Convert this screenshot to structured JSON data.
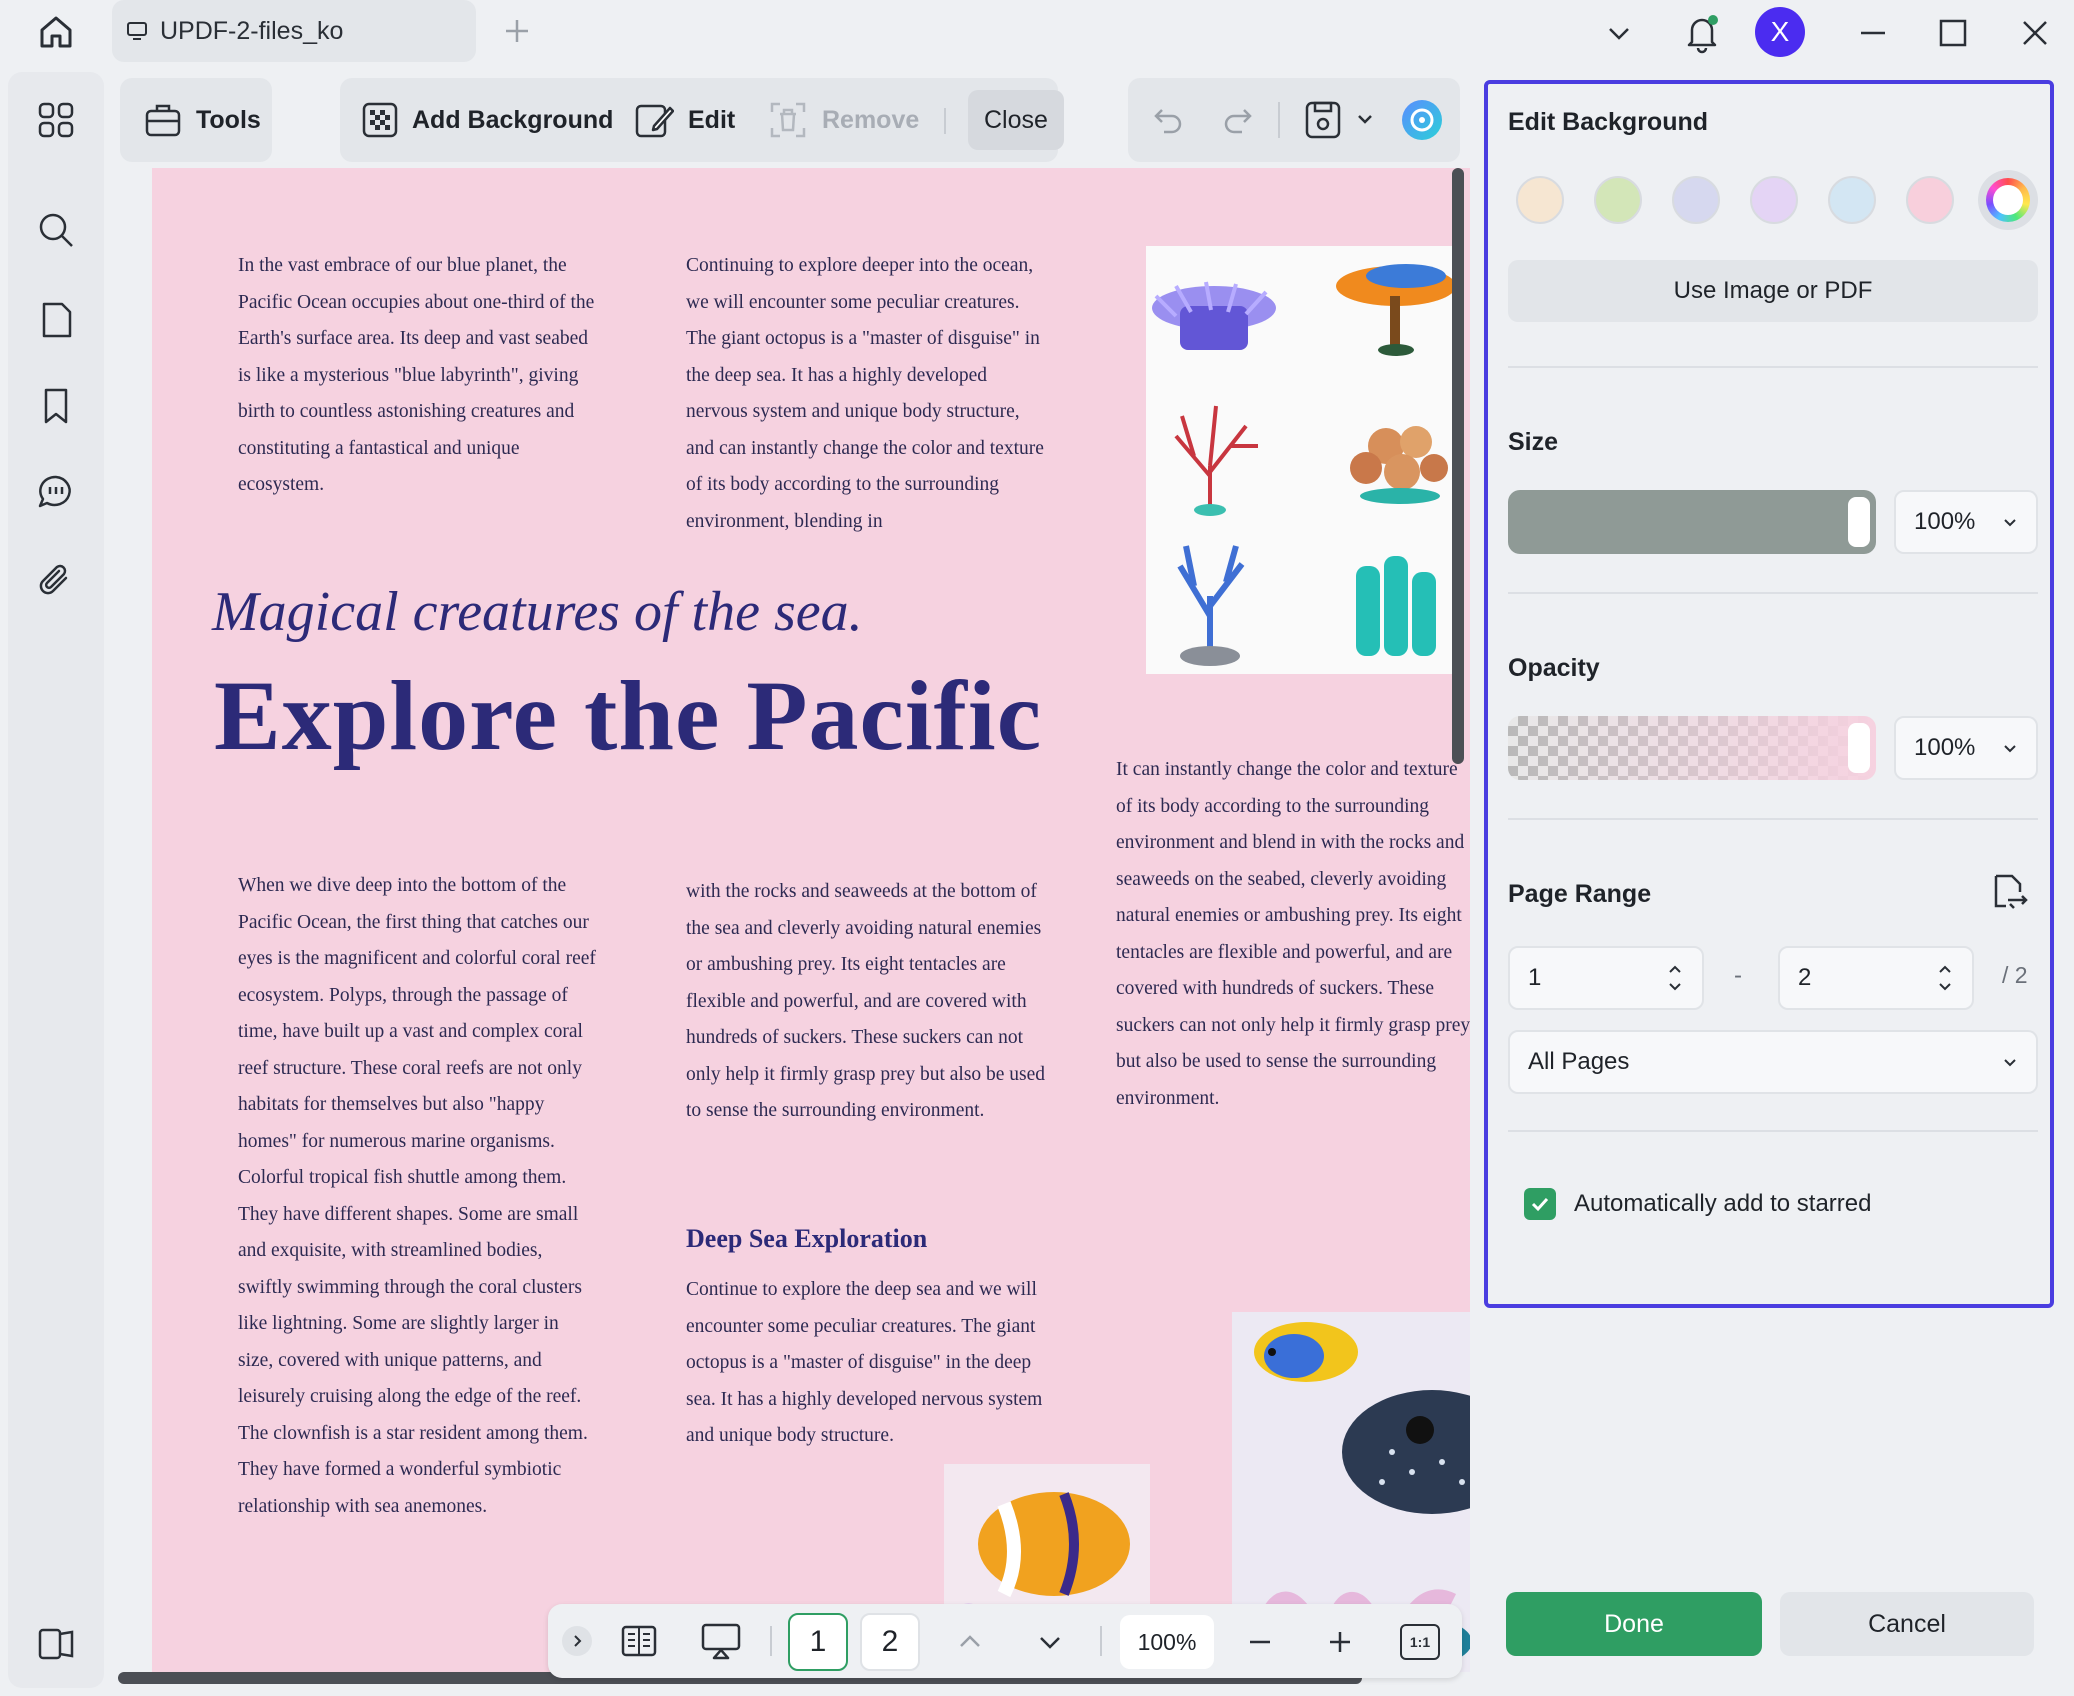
{
  "window": {
    "tab_title": "UPDF-2-files_ko",
    "avatar_letter": "X"
  },
  "toolbar": {
    "tools_label": "Tools",
    "add_background_label": "Add Background",
    "edit_label": "Edit",
    "remove_label": "Remove",
    "close_label": "Close"
  },
  "document": {
    "para1": "In the vast embrace of our blue planet, the Pacific Ocean occupies about one-third of the Earth's surface area. Its deep and vast seabed is like a mysterious \"blue labyrinth\", giving birth to countless astonishing creatures and constituting a fantastical and unique ecosystem.",
    "para2": "Continuing to explore deeper into the ocean, we will encounter some peculiar creatures. The giant octopus is a \"master of disguise\" in the deep sea. It has a highly developed nervous system and unique body structure, and can instantly change the color and texture of its body according to the surrounding environment, blending in",
    "subtitle": "Magical creatures of the sea.",
    "title": "Explore the Pacific",
    "para3": "It can instantly change the color and texture of its body according to the surrounding environment and blend in with the rocks and seaweeds on the seabed, cleverly avoiding natural enemies or ambushing prey. Its eight tentacles are flexible and powerful, and are covered with hundreds of suckers. These suckers can not only help it firmly grasp prey but also be used to sense the surrounding environment.",
    "para4": "When we dive deep into the bottom of the Pacific Ocean, the first thing that catches our eyes is the magnificent and colorful coral reef ecosystem. Polyps, through the passage of time, have built up a vast and complex coral reef structure. These coral reefs are not only habitats for themselves but also \"happy homes\" for numerous marine organisms. Colorful tropical fish shuttle among them. They have different shapes. Some are small and exquisite, with streamlined bodies, swiftly swimming through the coral clusters like lightning. Some are slightly larger in size, covered with unique patterns, and leisurely cruising along the edge of the reef. The clownfish is a star resident among them. They have formed a wonderful symbiotic relationship with sea anemones.",
    "para5": "with the rocks and seaweeds at the bottom of the sea and cleverly avoiding natural enemies or ambushing prey. Its eight tentacles are flexible and powerful, and are covered with hundreds of suckers. These suckers can not only help it firmly grasp prey but also be used to sense the surrounding environment.",
    "section_title": "Deep Sea Exploration",
    "para6": "Continue to explore the deep sea and we will encounter some peculiar creatures. The giant octopus is a \"master of disguise\" in the deep sea. It has a highly developed nervous system and unique body structure."
  },
  "panel": {
    "title": "Edit Background",
    "swatch_colors": [
      "#f6e6d2",
      "#d3e6b8",
      "#d6d8ef",
      "#e4d4f5",
      "#d3e6f3",
      "#f8cfdc"
    ],
    "use_image_label": "Use Image or PDF",
    "size_label": "Size",
    "size_value": "100%",
    "size_fraction": 1.0,
    "opacity_label": "Opacity",
    "opacity_value": "100%",
    "opacity_fraction": 1.0,
    "page_range_label": "Page Range",
    "range_from": "1",
    "range_sep": "-",
    "range_to": "2",
    "range_total": "/ 2",
    "pages_option": "All Pages",
    "auto_star_label": "Automatically add to starred",
    "auto_star_checked": true,
    "done_label": "Done",
    "cancel_label": "Cancel"
  },
  "pagebar": {
    "page1": "1",
    "page2": "2",
    "zoom": "100%",
    "fit_label": "1:1"
  },
  "colors": {
    "accent_green": "#2f9e63",
    "panel_border": "#4a3de0",
    "doc_background": "#f6d2e0",
    "headline": "#2c2a78"
  }
}
